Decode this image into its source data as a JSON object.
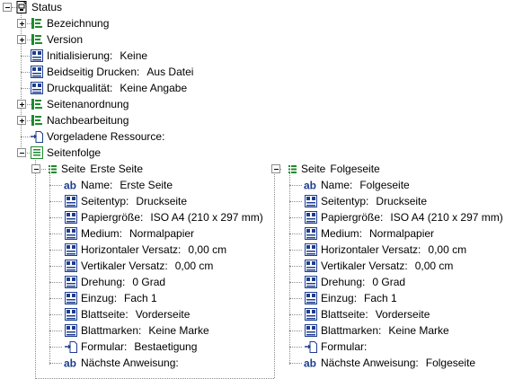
{
  "tree": {
    "root": {
      "label": "Status",
      "icon": "printer-page-icon"
    },
    "items": [
      {
        "label": "Bezeichnung",
        "value": "",
        "icon": "green-list-icon"
      },
      {
        "label": "Version",
        "value": "",
        "icon": "green-list-icon"
      },
      {
        "label": "Initialisierung:",
        "value": "Keine",
        "icon": "blue-property-icon"
      },
      {
        "label": "Beidseitig Drucken:",
        "value": "Aus Datei",
        "icon": "blue-property-icon"
      },
      {
        "label": "Druckqualität:",
        "value": "Keine Angabe",
        "icon": "blue-property-icon"
      },
      {
        "label": "Seitenanordnung",
        "value": "",
        "icon": "green-list-icon"
      },
      {
        "label": "Nachbearbeitung",
        "value": "",
        "icon": "green-list-icon"
      },
      {
        "label": "Vorgeladene Ressource:",
        "value": "",
        "icon": "resource-arrow-icon"
      },
      {
        "label": "Seitenfolge",
        "value": "",
        "icon": "green-list-icon"
      }
    ],
    "pages": [
      {
        "label": "Seite",
        "value": "Erste Seite",
        "icon": "green-list-small-icon",
        "props": [
          {
            "label": "Name:",
            "value": "Erste Seite",
            "icon": "ab-icon"
          },
          {
            "label": "Seitentyp:",
            "value": "Druckseite",
            "icon": "blue-property-icon"
          },
          {
            "label": "Papiergröße:",
            "value": "ISO A4 (210 x 297 mm)",
            "icon": "blue-property-icon"
          },
          {
            "label": "Medium:",
            "value": "Normalpapier",
            "icon": "blue-property-icon"
          },
          {
            "label": "Horizontaler Versatz:",
            "value": "0,00 cm",
            "icon": "blue-property-icon"
          },
          {
            "label": "Vertikaler Versatz:",
            "value": "0,00 cm",
            "icon": "blue-property-icon"
          },
          {
            "label": "Drehung:",
            "value": "0 Grad",
            "icon": "blue-property-icon"
          },
          {
            "label": "Einzug:",
            "value": "Fach 1",
            "icon": "blue-property-icon"
          },
          {
            "label": "Blattseite:",
            "value": "Vorderseite",
            "icon": "blue-property-icon"
          },
          {
            "label": "Blattmarken:",
            "value": "Keine Marke",
            "icon": "blue-property-icon"
          },
          {
            "label": "Formular:",
            "value": "Bestaetigung",
            "icon": "resource-arrow-icon"
          },
          {
            "label": "Nächste Anweisung:",
            "value": "",
            "icon": "ab-icon"
          }
        ]
      },
      {
        "label": "Seite",
        "value": "Folgeseite",
        "icon": "green-list-small-icon",
        "props": [
          {
            "label": "Name:",
            "value": "Folgeseite",
            "icon": "ab-icon"
          },
          {
            "label": "Seitentyp:",
            "value": "Druckseite",
            "icon": "blue-property-icon"
          },
          {
            "label": "Papiergröße:",
            "value": "ISO A4 (210 x 297 mm)",
            "icon": "blue-property-icon"
          },
          {
            "label": "Medium:",
            "value": "Normalpapier",
            "icon": "blue-property-icon"
          },
          {
            "label": "Horizontaler Versatz:",
            "value": "0,00 cm",
            "icon": "blue-property-icon"
          },
          {
            "label": "Vertikaler Versatz:",
            "value": "0,00 cm",
            "icon": "blue-property-icon"
          },
          {
            "label": "Drehung:",
            "value": "0 Grad",
            "icon": "blue-property-icon"
          },
          {
            "label": "Einzug:",
            "value": "Fach 1",
            "icon": "blue-property-icon"
          },
          {
            "label": "Blattseite:",
            "value": "Vorderseite",
            "icon": "blue-property-icon"
          },
          {
            "label": "Blattmarken:",
            "value": "Keine Marke",
            "icon": "blue-property-icon"
          },
          {
            "label": "Formular:",
            "value": "",
            "icon": "resource-arrow-icon"
          },
          {
            "label": "Nächste Anweisung:",
            "value": "Folgeseite",
            "icon": "ab-icon"
          }
        ]
      }
    ]
  },
  "colors": {
    "green": "#1f8a2e",
    "blue": "#1d3d8f",
    "connector": "#8c8c8c"
  }
}
